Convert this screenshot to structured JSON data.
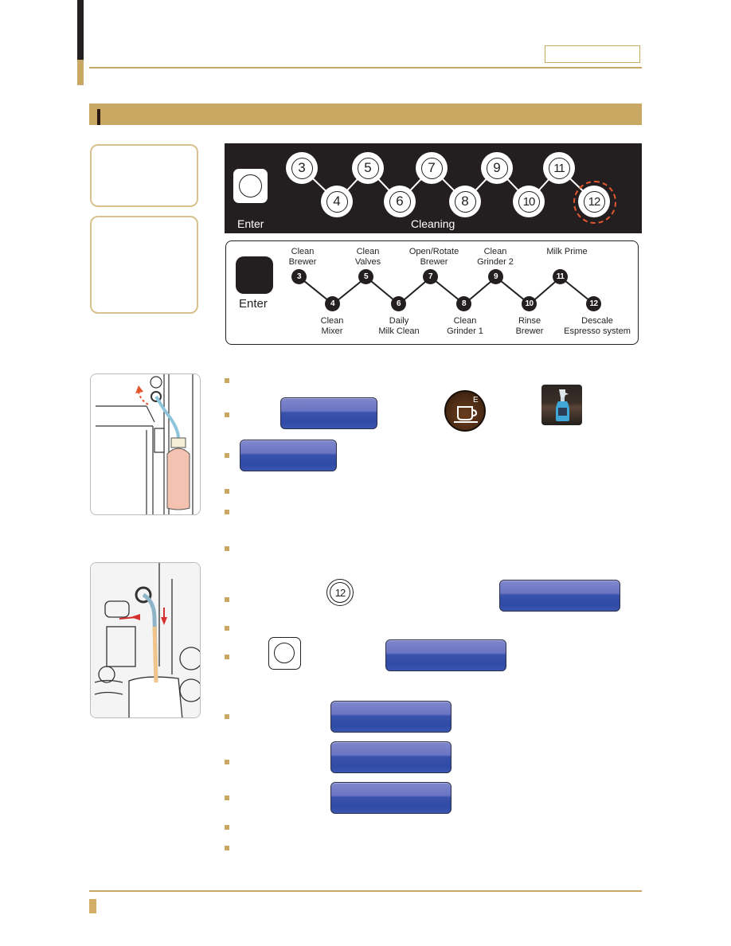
{
  "page": {
    "colors": {
      "gold": "#c9a863",
      "dark": "#231f20",
      "highlight_ring": "#e4572e",
      "button_blue": "#3a52aa"
    }
  },
  "panel_dark": {
    "enter_label": "Enter",
    "cleaning_label": "Cleaning",
    "dials": [
      "3",
      "4",
      "5",
      "6",
      "7",
      "8",
      "9",
      "10",
      "11",
      "12"
    ],
    "highlighted_dial": "12"
  },
  "panel_legend": {
    "enter_label": "Enter",
    "steps": [
      {
        "num": "3",
        "label_line1": "Clean",
        "label_line2": "Brewer",
        "position": "top"
      },
      {
        "num": "4",
        "label_line1": "Clean",
        "label_line2": "Mixer",
        "position": "bottom"
      },
      {
        "num": "5",
        "label_line1": "Clean",
        "label_line2": "Valves",
        "position": "top"
      },
      {
        "num": "6",
        "label_line1": "Daily",
        "label_line2": "Milk Clean",
        "position": "bottom"
      },
      {
        "num": "7",
        "label_line1": "Open/Rotate",
        "label_line2": "Brewer",
        "position": "top"
      },
      {
        "num": "8",
        "label_line1": "Clean",
        "label_line2": "Grinder 1",
        "position": "bottom"
      },
      {
        "num": "9",
        "label_line1": "Clean",
        "label_line2": "Grinder 2",
        "position": "top"
      },
      {
        "num": "10",
        "label_line1": "Rinse",
        "label_line2": "Brewer",
        "position": "bottom"
      },
      {
        "num": "11",
        "label_line1": "Milk Prime",
        "label_line2": "",
        "position": "top"
      },
      {
        "num": "12",
        "label_line1": "Descale",
        "label_line2": "Espresso system",
        "position": "bottom"
      }
    ]
  },
  "inline": {
    "dial_12": "12",
    "coffee_icon_letter": "E"
  }
}
